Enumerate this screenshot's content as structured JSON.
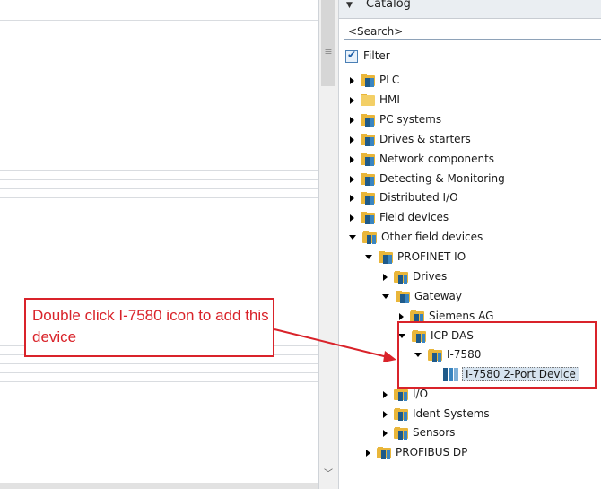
{
  "catalog": {
    "title": "Catalog",
    "search_placeholder": "<Search>",
    "filter_label": "Filter",
    "filter_checked": true
  },
  "tree": [
    {
      "label": "PLC",
      "state": "collapsed",
      "icon": "folder-icon"
    },
    {
      "label": "HMI",
      "state": "collapsed",
      "icon": "folder-empty-icon"
    },
    {
      "label": "PC systems",
      "state": "collapsed",
      "icon": "folder-icon"
    },
    {
      "label": "Drives & starters",
      "state": "collapsed",
      "icon": "folder-icon"
    },
    {
      "label": "Network components",
      "state": "collapsed",
      "icon": "folder-icon"
    },
    {
      "label": "Detecting & Monitoring",
      "state": "collapsed",
      "icon": "folder-icon"
    },
    {
      "label": "Distributed I/O",
      "state": "collapsed",
      "icon": "folder-icon"
    },
    {
      "label": "Field devices",
      "state": "collapsed",
      "icon": "folder-icon"
    },
    {
      "label": "Other field devices",
      "state": "expanded",
      "icon": "folder-icon"
    },
    {
      "label": "PROFINET IO",
      "state": "expanded",
      "icon": "folder-icon"
    },
    {
      "label": "Drives",
      "state": "collapsed",
      "icon": "folder-icon"
    },
    {
      "label": "Gateway",
      "state": "expanded",
      "icon": "folder-icon"
    },
    {
      "label": "Siemens AG",
      "state": "collapsed",
      "icon": "folder-icon"
    },
    {
      "label": "ICP DAS",
      "state": "expanded",
      "icon": "folder-icon"
    },
    {
      "label": "I-7580",
      "state": "expanded",
      "icon": "folder-icon"
    },
    {
      "label": "I-7580 2-Port Device",
      "state": "leaf",
      "icon": "device-icon"
    },
    {
      "label": "I/O",
      "state": "collapsed",
      "icon": "folder-icon"
    },
    {
      "label": "Ident Systems",
      "state": "collapsed",
      "icon": "folder-icon"
    },
    {
      "label": "Sensors",
      "state": "collapsed",
      "icon": "folder-icon"
    },
    {
      "label": "PROFIBUS DP",
      "state": "collapsed",
      "icon": "folder-icon"
    }
  ],
  "callout": {
    "text": "Double click I-7580 icon to add this device",
    "color": "#d9232a"
  }
}
